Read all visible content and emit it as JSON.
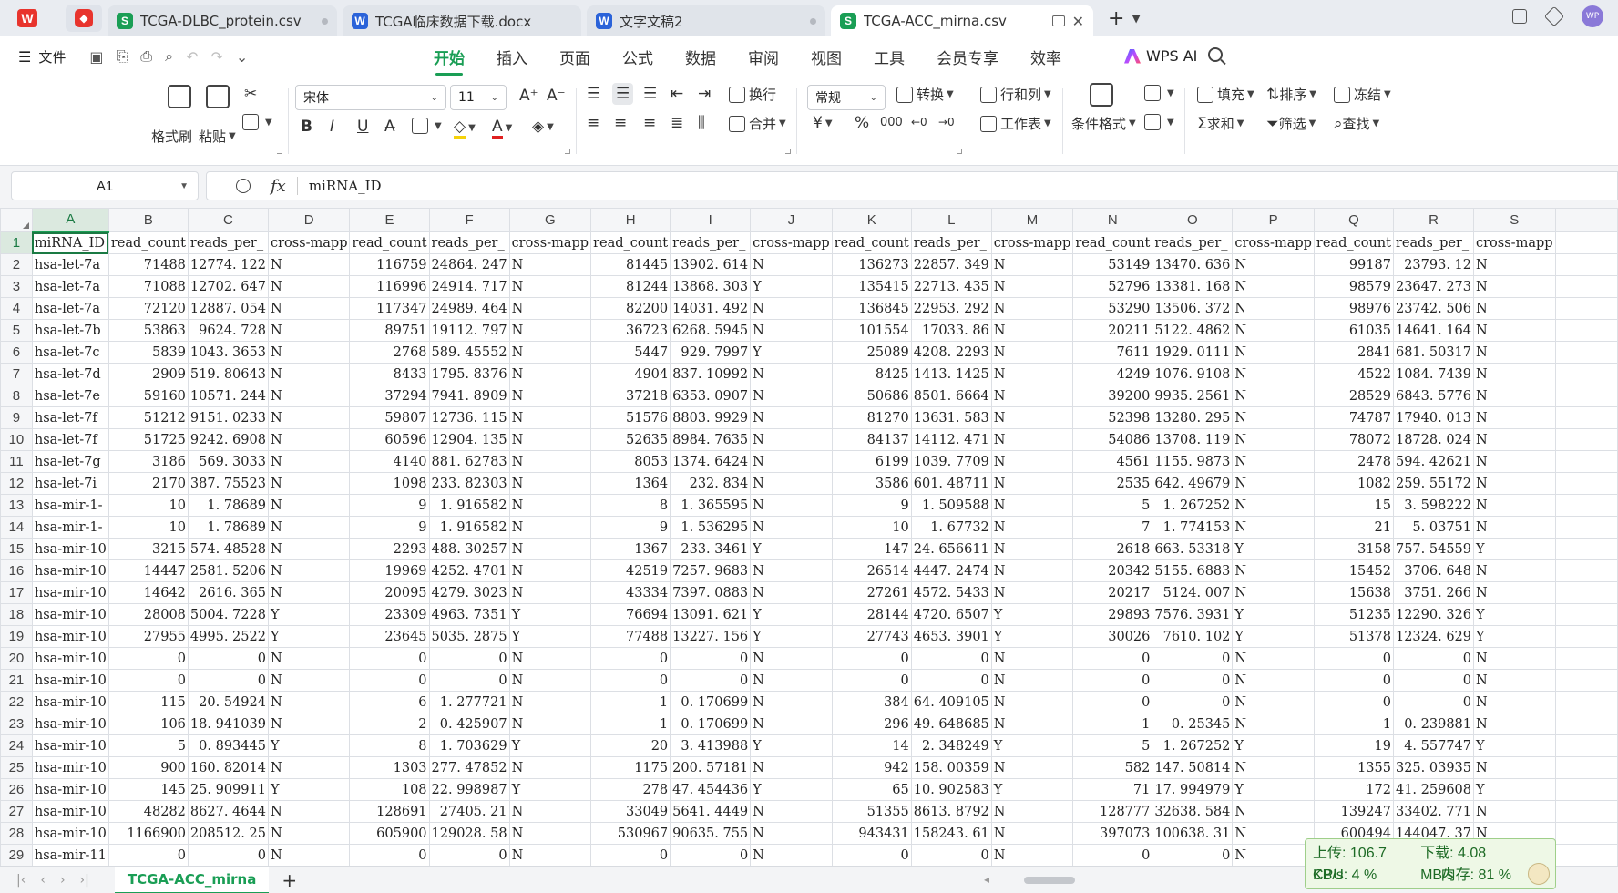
{
  "tabs": {
    "items": [
      {
        "label": "TCGA-DLBC_protein.csv",
        "type": "S",
        "state": "inactive",
        "modified": true
      },
      {
        "label": "TCGA临床数据下载.docx",
        "type": "W",
        "state": "inactive",
        "modified": false
      },
      {
        "label": "文字文稿2",
        "type": "W",
        "state": "inactive",
        "modified": true
      },
      {
        "label": "TCGA-ACC_mirna.csv",
        "type": "S",
        "state": "active",
        "modified": false
      }
    ],
    "add": "+",
    "avatar_text": "WP"
  },
  "menubar": {
    "file": "文件",
    "menus": [
      "开始",
      "插入",
      "页面",
      "公式",
      "数据",
      "审阅",
      "视图",
      "工具",
      "会员专享",
      "效率"
    ],
    "active_menu": "开始",
    "wps_ai": "WPS AI"
  },
  "ribbon": {
    "format_painter": "格式刷",
    "paste": "粘贴",
    "font_name": "宋体",
    "font_size": "11",
    "wrap": "换行",
    "merge": "合并",
    "number_format": "常规",
    "convert": "转换",
    "rows_cols": "行和列",
    "worksheet": "工作表",
    "cond_format": "条件格式",
    "fill": "填充",
    "sort": "排序",
    "freeze": "冻结",
    "sum": "求和",
    "filter": "筛选",
    "find": "查找",
    "bold": "B",
    "italic": "I",
    "underline": "U",
    "currency": "¥",
    "percent": "%"
  },
  "formula": {
    "cell_ref": "A1",
    "fx": "fx",
    "value": "miRNA_ID"
  },
  "sheet": {
    "columns": [
      "A",
      "B",
      "C",
      "D",
      "E",
      "F",
      "G",
      "H",
      "I",
      "J",
      "K",
      "L",
      "M",
      "N",
      "O",
      "P",
      "Q",
      "R",
      "S"
    ],
    "rows": [
      [
        "miRNA_ID",
        "read_count",
        "reads_per_",
        "cross-mapp",
        "read_count",
        "reads_per_",
        "cross-mapp",
        "read_count",
        "reads_per_",
        "cross-mapp",
        "read_count",
        "reads_per_",
        "cross-mapp",
        "read_count",
        "reads_per_",
        "cross-mapp",
        "read_count",
        "reads_per_",
        "cross-mapp"
      ],
      [
        "hsa-let-7a",
        "71488",
        "12774. 122",
        "N",
        "116759",
        "24864. 247",
        "N",
        "81445",
        "13902. 614",
        "N",
        "136273",
        "22857. 349",
        "N",
        "53149",
        "13470. 636",
        "N",
        "99187",
        "23793. 12",
        "N"
      ],
      [
        "hsa-let-7a",
        "71088",
        "12702. 647",
        "N",
        "116996",
        "24914. 717",
        "N",
        "81244",
        "13868. 303",
        "Y",
        "135415",
        "22713. 435",
        "N",
        "52796",
        "13381. 168",
        "N",
        "98579",
        "23647. 273",
        "N"
      ],
      [
        "hsa-let-7a",
        "72120",
        "12887. 054",
        "N",
        "117347",
        "24989. 464",
        "N",
        "82200",
        "14031. 492",
        "N",
        "136845",
        "22953. 292",
        "N",
        "53290",
        "13506. 372",
        "N",
        "98976",
        "23742. 506",
        "N"
      ],
      [
        "hsa-let-7b",
        "53863",
        "9624. 728",
        "N",
        "89751",
        "19112. 797",
        "N",
        "36723",
        "6268. 5945",
        "N",
        "101554",
        "17033. 86",
        "N",
        "20211",
        "5122. 4862",
        "N",
        "61035",
        "14641. 164",
        "N"
      ],
      [
        "hsa-let-7c",
        "5839",
        "1043. 3653",
        "N",
        "2768",
        "589. 45552",
        "N",
        "5447",
        "929. 7997",
        "Y",
        "25089",
        "4208. 2293",
        "N",
        "7611",
        "1929. 0111",
        "N",
        "2841",
        "681. 50317",
        "N"
      ],
      [
        "hsa-let-7d",
        "2909",
        "519. 80643",
        "N",
        "8433",
        "1795. 8376",
        "N",
        "4904",
        "837. 10992",
        "N",
        "8425",
        "1413. 1425",
        "N",
        "4249",
        "1076. 9108",
        "N",
        "4522",
        "1084. 7439",
        "N"
      ],
      [
        "hsa-let-7e",
        "59160",
        "10571. 244",
        "N",
        "37294",
        "7941. 8909",
        "N",
        "37218",
        "6353. 0907",
        "N",
        "50686",
        "8501. 6664",
        "N",
        "39200",
        "9935. 2561",
        "N",
        "28529",
        "6843. 5776",
        "N"
      ],
      [
        "hsa-let-7f",
        "51212",
        "9151. 0233",
        "N",
        "59807",
        "12736. 115",
        "N",
        "51576",
        "8803. 9929",
        "N",
        "81270",
        "13631. 583",
        "N",
        "52398",
        "13280. 295",
        "N",
        "74787",
        "17940. 013",
        "N"
      ],
      [
        "hsa-let-7f",
        "51725",
        "9242. 6908",
        "N",
        "60596",
        "12904. 135",
        "N",
        "52635",
        "8984. 7635",
        "N",
        "84137",
        "14112. 471",
        "N",
        "54086",
        "13708. 119",
        "N",
        "78072",
        "18728. 024",
        "N"
      ],
      [
        "hsa-let-7g",
        "3186",
        "569. 3033",
        "N",
        "4140",
        "881. 62783",
        "N",
        "8053",
        "1374. 6424",
        "N",
        "6199",
        "1039. 7709",
        "N",
        "4561",
        "1155. 9873",
        "N",
        "2478",
        "594. 42621",
        "N"
      ],
      [
        "hsa-let-7i",
        "2170",
        "387. 75523",
        "N",
        "1098",
        "233. 82303",
        "N",
        "1364",
        "232. 834",
        "N",
        "3586",
        "601. 48711",
        "N",
        "2535",
        "642. 49679",
        "N",
        "1082",
        "259. 55172",
        "N"
      ],
      [
        "hsa-mir-1-",
        "10",
        "1. 78689",
        "N",
        "9",
        "1. 916582",
        "N",
        "8",
        "1. 365595",
        "N",
        "9",
        "1. 509588",
        "N",
        "5",
        "1. 267252",
        "N",
        "15",
        "3. 598222",
        "N"
      ],
      [
        "hsa-mir-1-",
        "10",
        "1. 78689",
        "N",
        "9",
        "1. 916582",
        "N",
        "9",
        "1. 536295",
        "N",
        "10",
        "1. 67732",
        "N",
        "7",
        "1. 774153",
        "N",
        "21",
        "5. 03751",
        "N"
      ],
      [
        "hsa-mir-10",
        "3215",
        "574. 48528",
        "N",
        "2293",
        "488. 30257",
        "N",
        "1367",
        "233. 3461",
        "Y",
        "147",
        "24. 656611",
        "N",
        "2618",
        "663. 53318",
        "Y",
        "3158",
        "757. 54559",
        "Y"
      ],
      [
        "hsa-mir-10",
        "14447",
        "2581. 5206",
        "N",
        "19969",
        "4252. 4701",
        "N",
        "42519",
        "7257. 9683",
        "N",
        "26514",
        "4447. 2474",
        "N",
        "20342",
        "5155. 6883",
        "N",
        "15452",
        "3706. 648",
        "N"
      ],
      [
        "hsa-mir-10",
        "14642",
        "2616. 365",
        "N",
        "20095",
        "4279. 3023",
        "N",
        "43334",
        "7397. 0883",
        "N",
        "27261",
        "4572. 5433",
        "N",
        "20217",
        "5124. 007",
        "N",
        "15638",
        "3751. 266",
        "N"
      ],
      [
        "hsa-mir-10",
        "28008",
        "5004. 7228",
        "Y",
        "23309",
        "4963. 7351",
        "Y",
        "76694",
        "13091. 621",
        "Y",
        "28144",
        "4720. 6507",
        "Y",
        "29893",
        "7576. 3931",
        "Y",
        "51235",
        "12290. 326",
        "Y"
      ],
      [
        "hsa-mir-10",
        "27955",
        "4995. 2522",
        "Y",
        "23645",
        "5035. 2875",
        "Y",
        "77488",
        "13227. 156",
        "Y",
        "27743",
        "4653. 3901",
        "Y",
        "30026",
        "7610. 102",
        "Y",
        "51378",
        "12324. 629",
        "Y"
      ],
      [
        "hsa-mir-10",
        "0",
        "0",
        "N",
        "0",
        "0",
        "N",
        "0",
        "0",
        "N",
        "0",
        "0",
        "N",
        "0",
        "0",
        "N",
        "0",
        "0",
        "N"
      ],
      [
        "hsa-mir-10",
        "0",
        "0",
        "N",
        "0",
        "0",
        "N",
        "0",
        "0",
        "N",
        "0",
        "0",
        "N",
        "0",
        "0",
        "N",
        "0",
        "0",
        "N"
      ],
      [
        "hsa-mir-10",
        "115",
        "20. 54924",
        "N",
        "6",
        "1. 277721",
        "N",
        "1",
        "0. 170699",
        "N",
        "384",
        "64. 409105",
        "N",
        "0",
        "0",
        "N",
        "0",
        "0",
        "N"
      ],
      [
        "hsa-mir-10",
        "106",
        "18. 941039",
        "N",
        "2",
        "0. 425907",
        "N",
        "1",
        "0. 170699",
        "N",
        "296",
        "49. 648685",
        "N",
        "1",
        "0. 25345",
        "N",
        "1",
        "0. 239881",
        "N"
      ],
      [
        "hsa-mir-10",
        "5",
        "0. 893445",
        "Y",
        "8",
        "1. 703629",
        "Y",
        "20",
        "3. 413988",
        "Y",
        "14",
        "2. 348249",
        "Y",
        "5",
        "1. 267252",
        "Y",
        "19",
        "4. 557747",
        "Y"
      ],
      [
        "hsa-mir-10",
        "900",
        "160. 82014",
        "N",
        "1303",
        "277. 47852",
        "N",
        "1175",
        "200. 57181",
        "N",
        "942",
        "158. 00359",
        "N",
        "582",
        "147. 50814",
        "N",
        "1355",
        "325. 03935",
        "N"
      ],
      [
        "hsa-mir-10",
        "145",
        "25. 909911",
        "Y",
        "108",
        "22. 998987",
        "Y",
        "278",
        "47. 454436",
        "Y",
        "65",
        "10. 902583",
        "Y",
        "71",
        "17. 994979",
        "Y",
        "172",
        "41. 259608",
        "Y"
      ],
      [
        "hsa-mir-10",
        "48282",
        "8627. 4644",
        "N",
        "128691",
        "27405. 21",
        "N",
        "33049",
        "5641. 4449",
        "N",
        "51355",
        "8613. 8792",
        "N",
        "128777",
        "32638. 584",
        "N",
        "139247",
        "33402. 771",
        "N"
      ],
      [
        "hsa-mir-10",
        "1166900",
        "208512. 25",
        "N",
        "605900",
        "129028. 58",
        "N",
        "530967",
        "90635. 755",
        "N",
        "943431",
        "158243. 61",
        "N",
        "397073",
        "100638. 31",
        "N",
        "600494",
        "144047. 37",
        "N"
      ],
      [
        "hsa-mir-11",
        "0",
        "0",
        "N",
        "0",
        "0",
        "N",
        "0",
        "0",
        "N",
        "0",
        "0",
        "N",
        "0",
        "0",
        "N",
        "0",
        "0",
        "N"
      ]
    ]
  },
  "bottom": {
    "sheet_tab": "TCGA-ACC_mirna",
    "add": "+"
  },
  "netmon": {
    "upload": "上传: 106.7 KB/s",
    "download": "下载: 4.08 MB/s",
    "cpu": "CPU: 4 %",
    "memory": "内存: 81 %"
  },
  "colors": {
    "accent": "#1a9e55",
    "sheet_icon": "#1a9e55",
    "word_icon": "#2b63d9",
    "wps_red": "#e8342d"
  }
}
